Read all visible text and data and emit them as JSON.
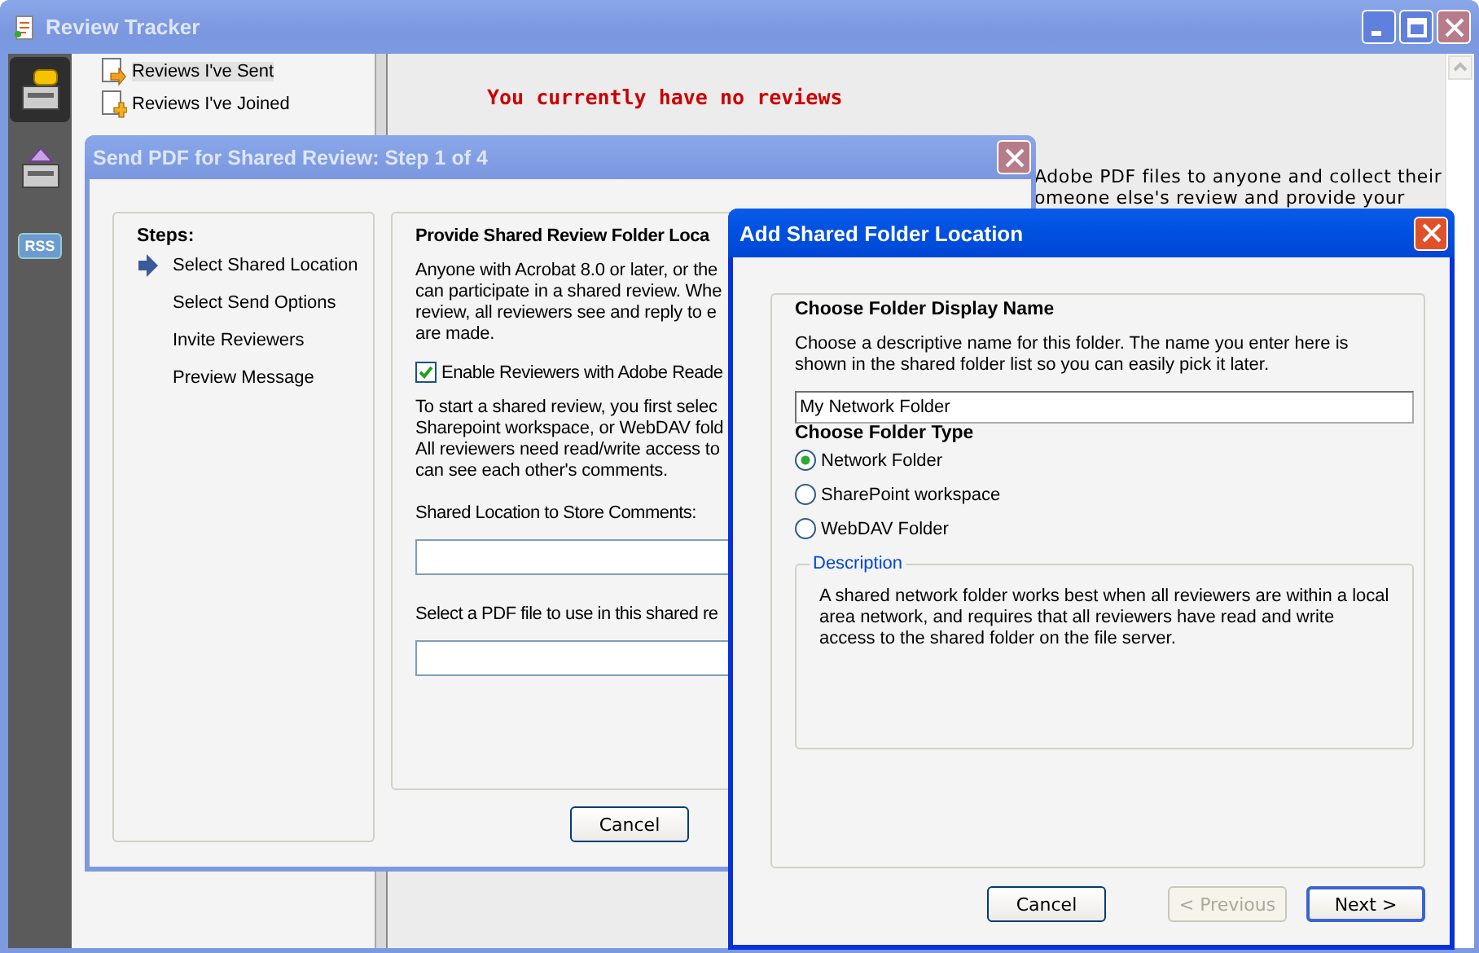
{
  "window": {
    "title": "Review Tracker"
  },
  "tools": [
    {
      "kind": "tray-chat",
      "selected": true
    },
    {
      "kind": "tray-envelope",
      "selected": false
    },
    {
      "kind": "badge",
      "label": "RSS",
      "selected": false
    }
  ],
  "nav": {
    "items": [
      {
        "kind": "sent",
        "label": "Reviews I've Sent",
        "selected": true
      },
      {
        "kind": "joined",
        "label": "Reviews I've Joined",
        "selected": false
      }
    ]
  },
  "content": {
    "message": "You currently have no reviews",
    "lines": [
      "Adobe PDF files to anyone and collect their",
      "omeone else's review and provide your"
    ]
  },
  "wizard": {
    "title": "Send PDF for Shared Review: Step 1 of 4",
    "steps_heading": "Steps:",
    "steps": [
      {
        "label": "Select Shared Location",
        "selected": true
      },
      {
        "label": "Select Send Options",
        "selected": false
      },
      {
        "label": "Invite Reviewers",
        "selected": false
      },
      {
        "label": "Preview Message",
        "selected": false
      }
    ],
    "heading": "Provide Shared Review Folder Loca",
    "intro": [
      "Anyone with Acrobat 8.0 or later, or the",
      "can participate in a shared review. Whe",
      "review, all reviewers see and reply to e",
      "are made."
    ],
    "checkbox": {
      "label": "Enable Reviewers with Adobe Reade",
      "checked": true
    },
    "explanation": [
      "To start a shared review, you first selec",
      "Sharepoint workspace, or WebDAV fold",
      "All reviewers need read/write access to",
      "can see each other's comments."
    ],
    "fields": [
      {
        "label": "Shared Location to Store Comments:"
      },
      {
        "label": "Select a PDF file to use in this shared re"
      }
    ],
    "buttons": [
      "Cancel"
    ]
  },
  "folder_dialog": {
    "title": "Add Shared Folder Location",
    "name_heading": "Choose Folder Display Name",
    "name_help": "Choose a descriptive name for this folder. The name you enter here is shown in the shared folder list so you can easily pick it later.",
    "name_field": {
      "value": "My Network Folder"
    },
    "type_heading": "Choose Folder Type",
    "options": [
      {
        "label": "Network Folder",
        "selected": true
      },
      {
        "label": "SharePoint workspace",
        "selected": false
      },
      {
        "label": "WebDAV Folder",
        "selected": false
      }
    ],
    "description": {
      "legend": "Description",
      "text": "A shared network folder works best when all reviewers are within a local area network, and requires that all reviewers have read and write access to the shared folder on the file server."
    },
    "buttons": [
      {
        "label": "Cancel",
        "disabled": false,
        "default": false
      },
      {
        "label": "< Previous",
        "disabled": true,
        "default": false
      },
      {
        "label": "Next >",
        "disabled": false,
        "default": true
      }
    ]
  }
}
